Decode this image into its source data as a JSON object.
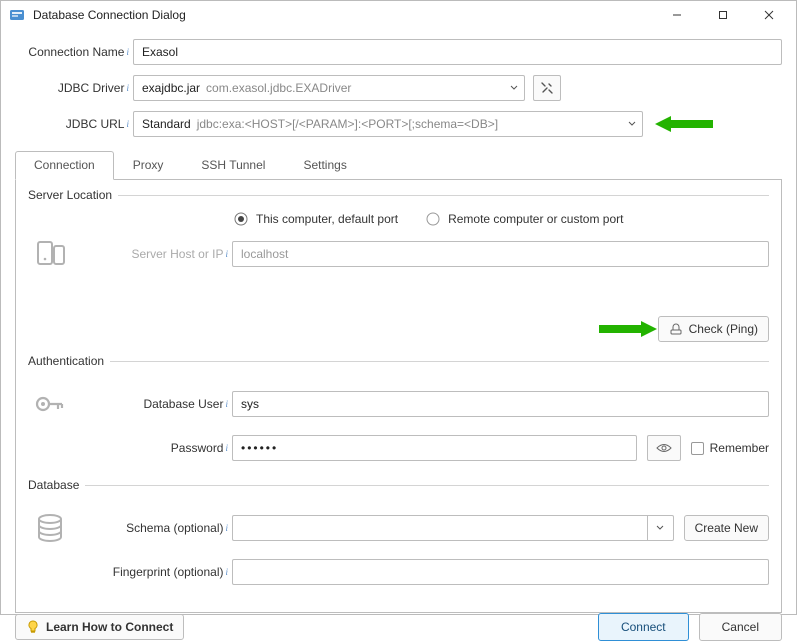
{
  "window": {
    "title": "Database Connection Dialog"
  },
  "labels": {
    "connection_name": "Connection Name",
    "jdbc_driver": "JDBC Driver",
    "jdbc_url": "JDBC URL"
  },
  "fields": {
    "connection_name": "Exasol",
    "driver_name": "exajdbc.jar",
    "driver_class": "com.exasol.jdbc.EXADriver",
    "url_mode": "Standard",
    "url_template": "jdbc:exa:<HOST>[/<PARAM>]:<PORT>[;schema=<DB>]"
  },
  "tabs": {
    "connection": "Connection",
    "proxy": "Proxy",
    "ssh": "SSH Tunnel",
    "settings": "Settings"
  },
  "server_location": {
    "legend": "Server Location",
    "radio_local": "This computer, default port",
    "radio_remote": "Remote computer or custom port",
    "host_label": "Server Host or IP",
    "host_value": "localhost",
    "ping_label": "Check (Ping)"
  },
  "auth": {
    "legend": "Authentication",
    "user_label": "Database User",
    "user_value": "sys",
    "password_label": "Password",
    "password_value": "••••••",
    "remember_label": "Remember"
  },
  "db": {
    "legend": "Database",
    "schema_label": "Schema (optional)",
    "schema_value": "",
    "create_new": "Create New",
    "fingerprint_label": "Fingerprint (optional)",
    "fingerprint_value": ""
  },
  "footer": {
    "learn": "Learn How to Connect",
    "connect": "Connect",
    "cancel": "Cancel"
  }
}
